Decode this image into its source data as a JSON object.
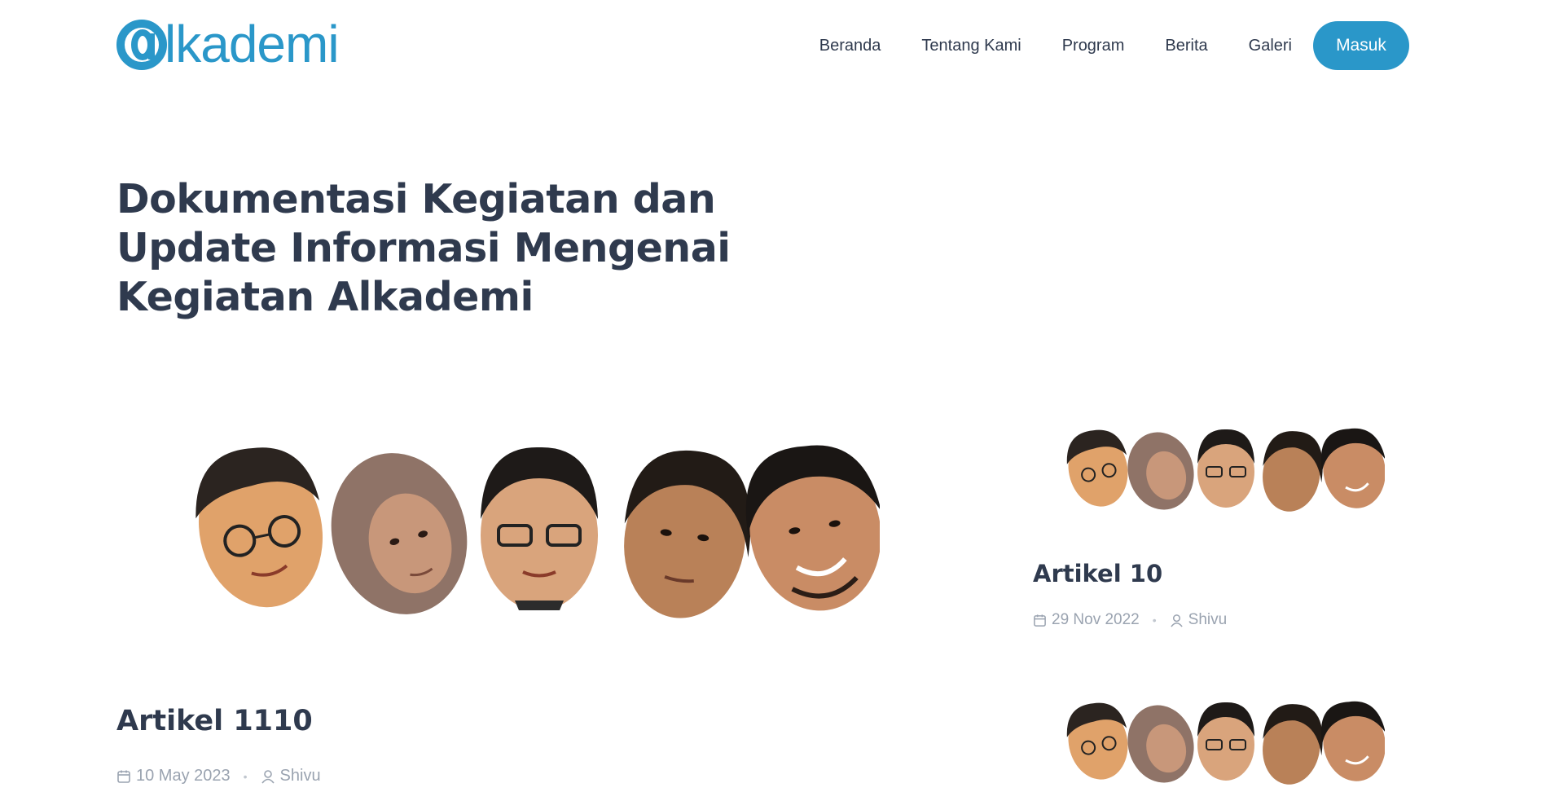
{
  "brand": {
    "logo_text": "lkademi",
    "logo_color": "#2a97c9"
  },
  "nav": {
    "items": [
      "Beranda",
      "Tentang Kami",
      "Program",
      "Berita",
      "Galeri"
    ],
    "login_label": "Masuk"
  },
  "hero": {
    "title_lines": [
      "Dokumentasi Kegiatan dan",
      "Update Informasi Mengenai",
      "Kegiatan Alkademi"
    ]
  },
  "main_post": {
    "title": "Artikel 1110",
    "date": "10 May 2023",
    "author": "Shivu"
  },
  "side_posts": [
    {
      "title": "Artikel 10",
      "date": "29 Nov 2022",
      "author": "Shivu"
    }
  ],
  "colors": {
    "accent": "#2a97c9",
    "text": "#2f3a4e",
    "muted": "#9aa3b0"
  },
  "icons": {
    "date": "calendar-icon",
    "author": "user-icon"
  }
}
